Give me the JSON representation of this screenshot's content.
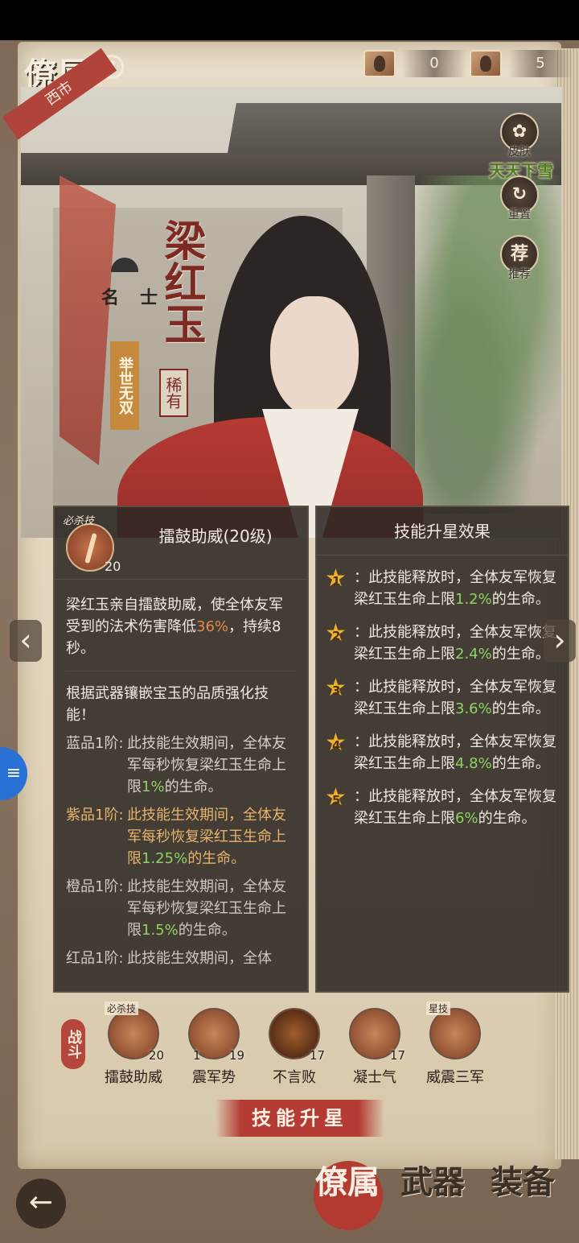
{
  "header": {
    "title": "僚属",
    "help": "?",
    "resources": [
      {
        "icon": "portrait-token-icon",
        "value": "0"
      },
      {
        "icon": "scroll-token-icon",
        "value": "5"
      }
    ]
  },
  "hero": {
    "region": "西市",
    "name": "梁红玉",
    "rarity": "稀有",
    "class": "名士",
    "title_badge": "举世无双",
    "skin_name": "天天下雪"
  },
  "side_buttons": [
    {
      "icon": "skin-icon",
      "label": "皮肤"
    },
    {
      "icon": "reset-icon",
      "label": "重置"
    },
    {
      "icon": "recommend-icon",
      "glyph": "荐",
      "label": "推荐"
    }
  ],
  "skill_detail": {
    "tag": "必杀技",
    "title": "擂鼓助威(20级)",
    "level": "20",
    "desc_a": "梁红玉亲自擂鼓助威，使全体友军受到的法术伤害降低",
    "desc_pct": "36%",
    "desc_b": "，持续8秒。",
    "note": "根据武器镶嵌宝玉的品质强化技能！",
    "tiers": [
      {
        "name": "蓝品1阶:",
        "a": "此技能生效期间，全体友军每秒恢复梁红玉生命上限",
        "pct": "1%",
        "b": "的生命。"
      },
      {
        "name": "紫品1阶:",
        "a": "此技能生效期间，全体友军每秒恢复梁红玉生命上限",
        "pct": "1.25%",
        "b": "的生命。"
      },
      {
        "name": "橙品1阶:",
        "a": "此技能生效期间，全体友军每秒恢复梁红玉生命上限",
        "pct": "1.5%",
        "b": "的生命。"
      },
      {
        "name": "红品1阶:",
        "a": "此技能生效期间，全体",
        "pct": "",
        "b": ""
      }
    ]
  },
  "star_effects": {
    "title": "技能升星效果",
    "items": [
      {
        "star": "1",
        "a": "：此技能释放时，全体友军恢复梁红玉生命上限",
        "pct": "1.2%",
        "b": "的生命。"
      },
      {
        "star": "2",
        "a": "：此技能释放时，全体友军恢复梁红玉生命上限",
        "pct": "2.4%",
        "b": "的生命。"
      },
      {
        "star": "3",
        "a": "：此技能释放时，全体友军恢复梁红玉生命上限",
        "pct": "3.6%",
        "b": "的生命。"
      },
      {
        "star": "4",
        "a": "：此技能释放时，全体友军恢复梁红玉生命上限",
        "pct": "4.8%",
        "b": "的生命。"
      },
      {
        "star": "5",
        "a": "：此技能释放时，全体友军恢复梁红玉生命上限",
        "pct": "6%",
        "b": "的生命。"
      }
    ]
  },
  "skill_bar": {
    "category": "战斗",
    "skills": [
      {
        "name": "擂鼓助威",
        "level": "20",
        "badge": "必杀技",
        "stars": ""
      },
      {
        "name": "震军势",
        "level": "19",
        "badge": "",
        "stars": "1"
      },
      {
        "name": "不言败",
        "level": "17",
        "badge": "",
        "stars": ""
      },
      {
        "name": "凝士气",
        "level": "17",
        "badge": "",
        "stars": ""
      },
      {
        "name": "威震三军",
        "level": "",
        "badge": "星技",
        "stars": ""
      }
    ],
    "upgrade_label": "技能升星"
  },
  "bottom_nav": {
    "back": "←",
    "tabs": [
      "僚属",
      "武器",
      "装备"
    ]
  }
}
